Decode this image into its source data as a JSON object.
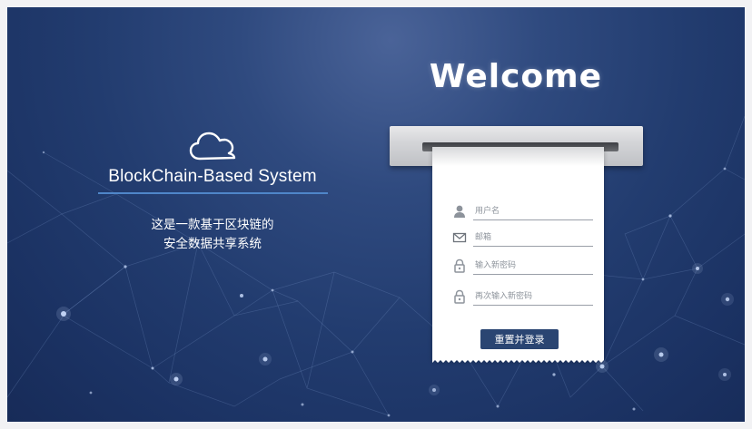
{
  "brand": {
    "title": "BlockChain-Based System",
    "description_line1": "这是一款基于区块链的",
    "description_line2": "安全数据共享系统",
    "icon": "cloud-icon"
  },
  "welcome": {
    "heading": "Welcome"
  },
  "form": {
    "username": {
      "placeholder": "用户名",
      "value": "",
      "icon": "user-icon"
    },
    "email": {
      "placeholder": "邮箱",
      "value": "",
      "icon": "envelope-icon"
    },
    "new_password": {
      "placeholder": "输入新密码",
      "value": "",
      "icon": "lock-icon"
    },
    "confirm_password": {
      "placeholder": "再次输入新密码",
      "value": "",
      "icon": "lock-icon"
    },
    "submit_label": "重置并登录"
  },
  "colors": {
    "background_top": "#4a6398",
    "background_bottom": "#172b58",
    "accent_underline": "#4f86c9",
    "button": "#2a4572"
  }
}
